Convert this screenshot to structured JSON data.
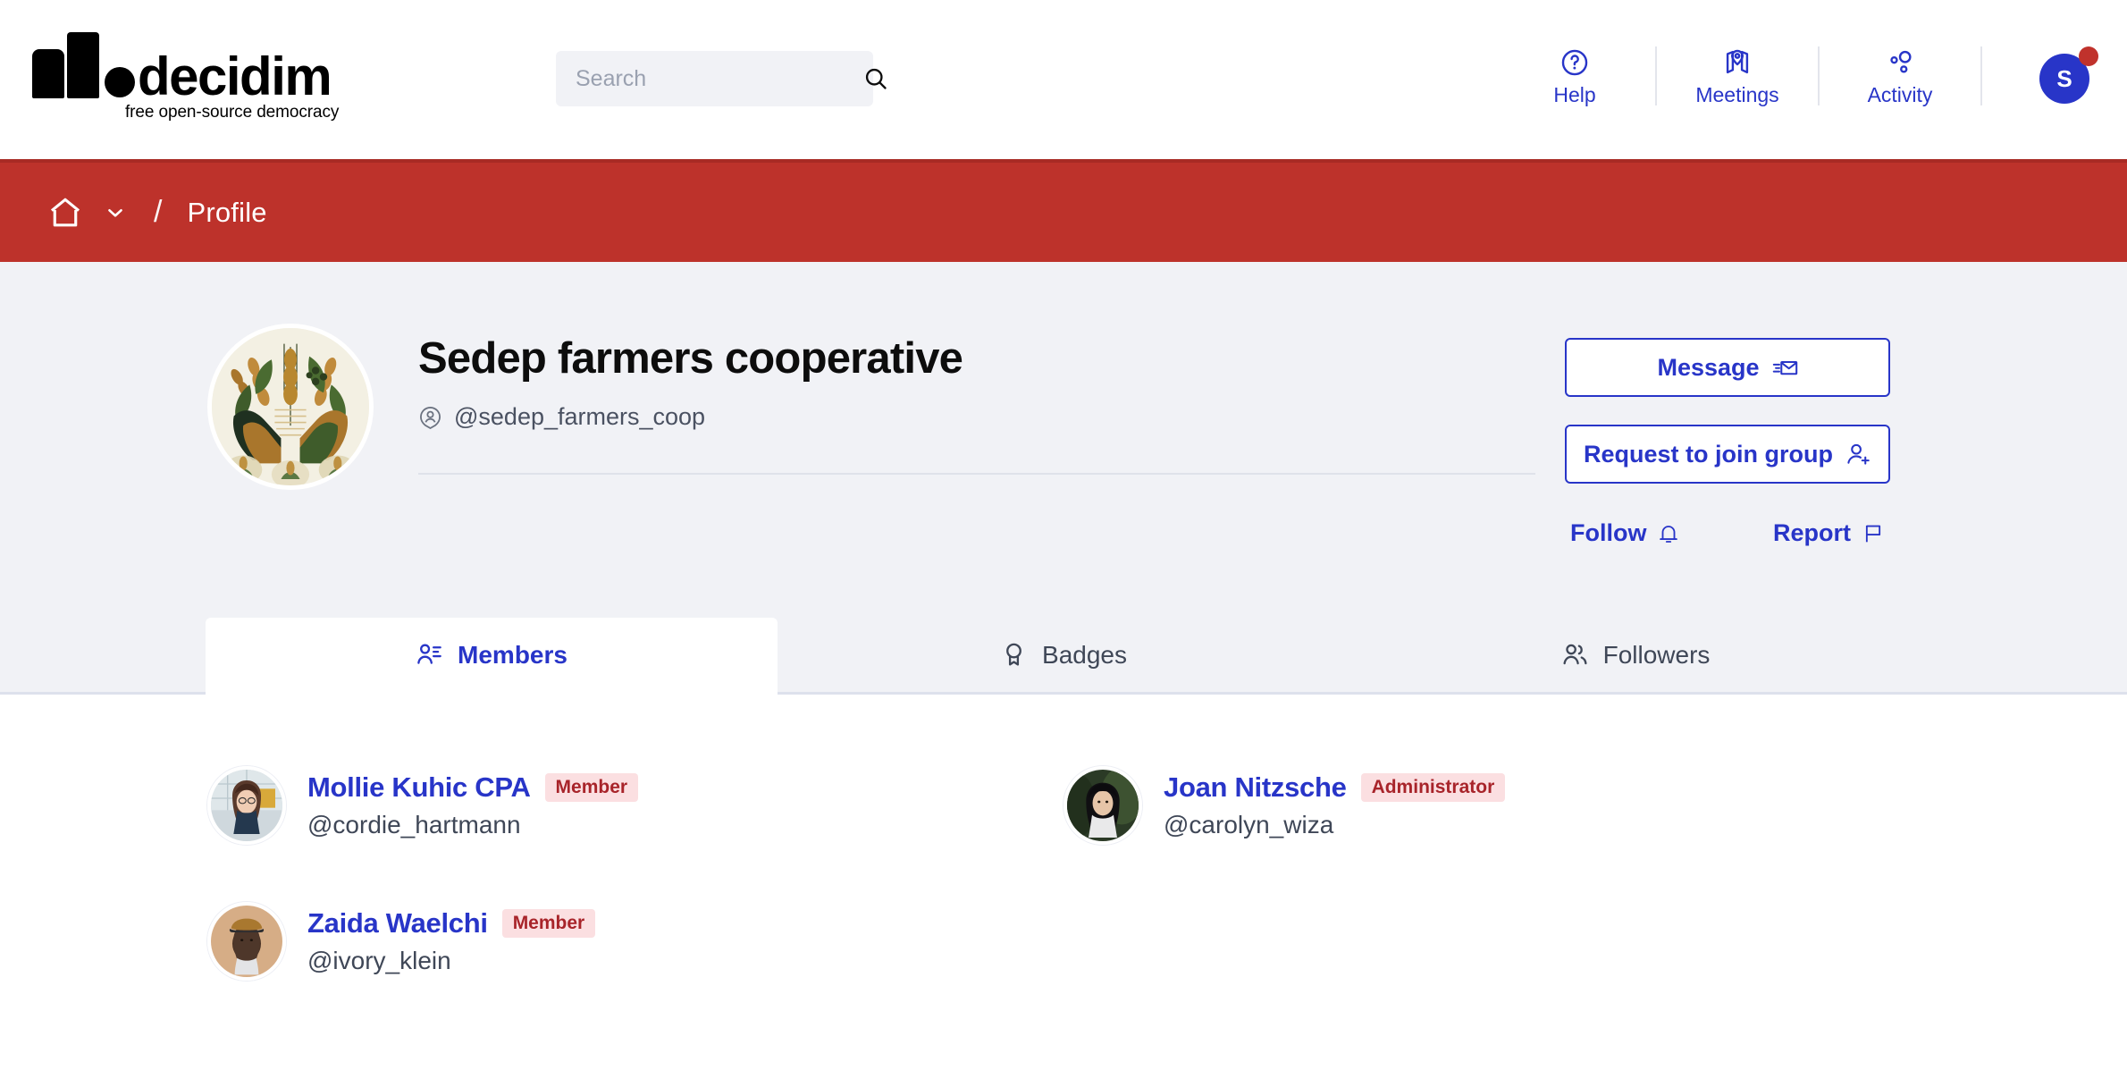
{
  "header": {
    "logo": {
      "word": "decidim",
      "tagline": "free open-source democracy",
      "icon": "decidim-logo"
    },
    "search": {
      "placeholder": "Search",
      "value": "",
      "icon": "search-icon"
    },
    "nav": [
      {
        "label": "Help",
        "icon": "help-circle-icon"
      },
      {
        "label": "Meetings",
        "icon": "map-pin-icon"
      },
      {
        "label": "Activity",
        "icon": "activity-circles-icon"
      }
    ],
    "account": {
      "initial": "S",
      "has_notification": true,
      "accent": "#2835c8",
      "dot_color": "#c0322c"
    }
  },
  "breadcrumb": {
    "home_icon": "home-icon",
    "chevron_icon": "chevron-down-icon",
    "separator": "/",
    "current": "Profile",
    "bar_color": "#bd322b"
  },
  "profile": {
    "avatar_alt": "sedep-farmers-cooperative-avatar",
    "name": "Sedep farmers cooperative",
    "nickname": "@sedep_farmers_coop",
    "nickname_icon": "account-circle-icon",
    "actions": {
      "message": {
        "label": "Message",
        "icon": "mail-send-icon"
      },
      "join": {
        "label": "Request to join group",
        "icon": "user-add-icon"
      },
      "follow": {
        "label": "Follow",
        "icon": "bell-icon"
      },
      "report": {
        "label": "Report",
        "icon": "flag-icon"
      }
    }
  },
  "tabs": [
    {
      "label": "Members",
      "icon": "members-icon",
      "active": true
    },
    {
      "label": "Badges",
      "icon": "badge-medal-icon",
      "active": false
    },
    {
      "label": "Followers",
      "icon": "followers-icon",
      "active": false
    }
  ],
  "members": [
    {
      "name": "Mollie Kuhic CPA",
      "role": "Member",
      "handle": "@cordie_hartmann",
      "avatar": "photo-woman-long-hair"
    },
    {
      "name": "Joan Nitzsche",
      "role": "Administrator",
      "handle": "@carolyn_wiza",
      "avatar": "photo-woman-dark-hair"
    },
    {
      "name": "Zaida Waelchi",
      "role": "Member",
      "handle": "@ivory_klein",
      "avatar": "photo-man-cap"
    }
  ],
  "colors": {
    "accent_blue": "#2835c8",
    "breadcrumb_red": "#bd322b",
    "badge_bg": "#fbdfe1",
    "badge_text": "#a8242a",
    "panel_bg": "#f1f2f6"
  }
}
